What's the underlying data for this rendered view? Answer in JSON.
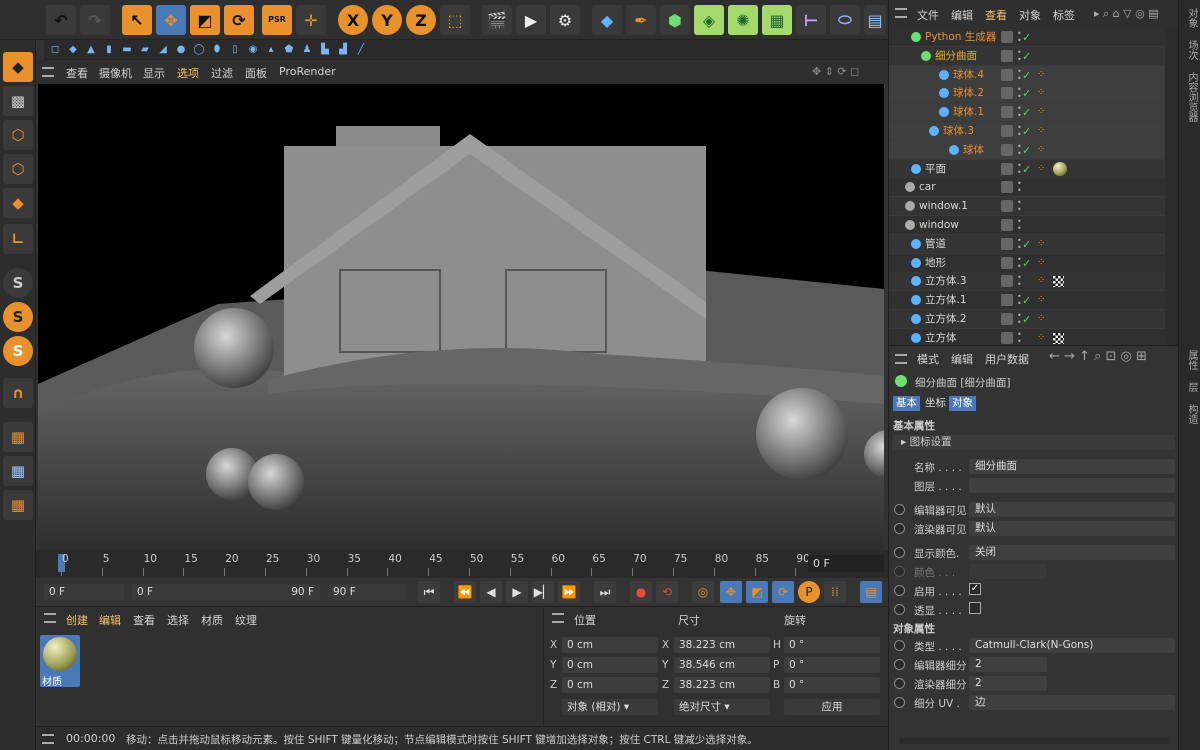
{
  "toolbar": {
    "x_label": "X",
    "y_label": "Y",
    "z_label": "Z",
    "psr_label": "PSR"
  },
  "viewport_menu": [
    "查看",
    "摄像机",
    "显示",
    "选项",
    "过滤",
    "面板",
    "ProRender"
  ],
  "timeline": {
    "ticks": [
      "0",
      "5",
      "10",
      "15",
      "20",
      "25",
      "30",
      "35",
      "40",
      "45",
      "50",
      "55",
      "60",
      "65",
      "70",
      "75",
      "80",
      "85",
      "90"
    ],
    "frame_display": "0 F"
  },
  "playbar": {
    "start": "0 F",
    "range_start": "0 F",
    "range_end": "90 F",
    "end": "90 F"
  },
  "material_panel": {
    "menu": [
      "创建",
      "编辑",
      "查看",
      "选择",
      "材质",
      "纹理"
    ],
    "material_name": "材质"
  },
  "coords": {
    "headers": {
      "position": "位置",
      "size": "尺寸",
      "rotation": "旋转"
    },
    "rows": [
      {
        "axis": "X",
        "pos": "0 cm",
        "size_axis": "X",
        "size": "38.223 cm",
        "rot_axis": "H",
        "rot": "0 °"
      },
      {
        "axis": "Y",
        "pos": "0 cm",
        "size_axis": "Y",
        "size": "38.546 cm",
        "rot_axis": "P",
        "rot": "0 °"
      },
      {
        "axis": "Z",
        "pos": "0 cm",
        "size_axis": "Z",
        "size": "38.223 cm",
        "rot_axis": "B",
        "rot": "0 °"
      }
    ],
    "mode": "对象 (相对)",
    "size_mode": "绝对尺寸",
    "apply": "应用"
  },
  "status": {
    "time": "00:00:00",
    "message": "移动：点击并拖动鼠标移动元素。按住 SHIFT 键量化移动；节点编辑模式时按住 SHIFT 键增加选择对象；按住 CTRL 键减少选择对象。"
  },
  "object_manager": {
    "menu": [
      "文件",
      "编辑",
      "查看",
      "对象",
      "标签"
    ],
    "objects": [
      {
        "name": "Python 生成器",
        "color": "#e8912d"
      },
      {
        "name": "细分曲面",
        "color": "#f5a623"
      },
      {
        "name": "球体.4",
        "color": "#e8912d"
      },
      {
        "name": "球体.2",
        "color": "#e8912d"
      },
      {
        "name": "球体.1",
        "color": "#e8912d"
      },
      {
        "name": "球体.3",
        "color": "#e8912d"
      },
      {
        "name": "球体",
        "color": "#e8912d"
      },
      {
        "name": "平面",
        "color": "#d8d8d8"
      },
      {
        "name": "car",
        "color": "#d8d8d8"
      },
      {
        "name": "window.1",
        "color": "#d8d8d8"
      },
      {
        "name": "window",
        "color": "#d8d8d8"
      },
      {
        "name": "管道",
        "color": "#d8d8d8"
      },
      {
        "name": "地形",
        "color": "#d8d8d8"
      },
      {
        "name": "立方体.3",
        "color": "#d8d8d8"
      },
      {
        "name": "立方体.1",
        "color": "#d8d8d8"
      },
      {
        "name": "立方体.2",
        "color": "#d8d8d8"
      },
      {
        "name": "立方体",
        "color": "#d8d8d8"
      }
    ]
  },
  "attr_manager": {
    "menu": [
      "模式",
      "编辑",
      "用户数据"
    ],
    "title": "细分曲面 [细分曲面]",
    "tabs": [
      "基本",
      "坐标",
      "对象"
    ],
    "basic_header": "基本属性",
    "icon_settings": "图标设置",
    "name_label": "名称 . . . .",
    "name_value": "细分曲面",
    "layer_label": "图层 . . . .",
    "editor_visible_label": "编辑器可见",
    "editor_visible_value": "默认",
    "render_visible_label": "渲染器可见",
    "render_visible_value": "默认",
    "display_color_label": "显示颜色.",
    "display_color_value": "关闭",
    "color_label": "颜色 . . .",
    "enabled_label": "启用 . . . .",
    "xray_label": "透显 . . . .",
    "object_header": "对象属性",
    "type_label": "类型 . . . .",
    "type_value": "Catmull-Clark(N-Gons)",
    "editor_subdiv_label": "编辑器细分",
    "editor_subdiv_value": "2",
    "render_subdiv_label": "渲染器细分",
    "render_subdiv_value": "2",
    "uv_label": "细分 UV .",
    "uv_value": "边"
  },
  "right_strip": {
    "top": [
      "对象",
      "场次",
      "内容浏览器"
    ],
    "bottom": [
      "属性",
      "层",
      "构造"
    ]
  }
}
